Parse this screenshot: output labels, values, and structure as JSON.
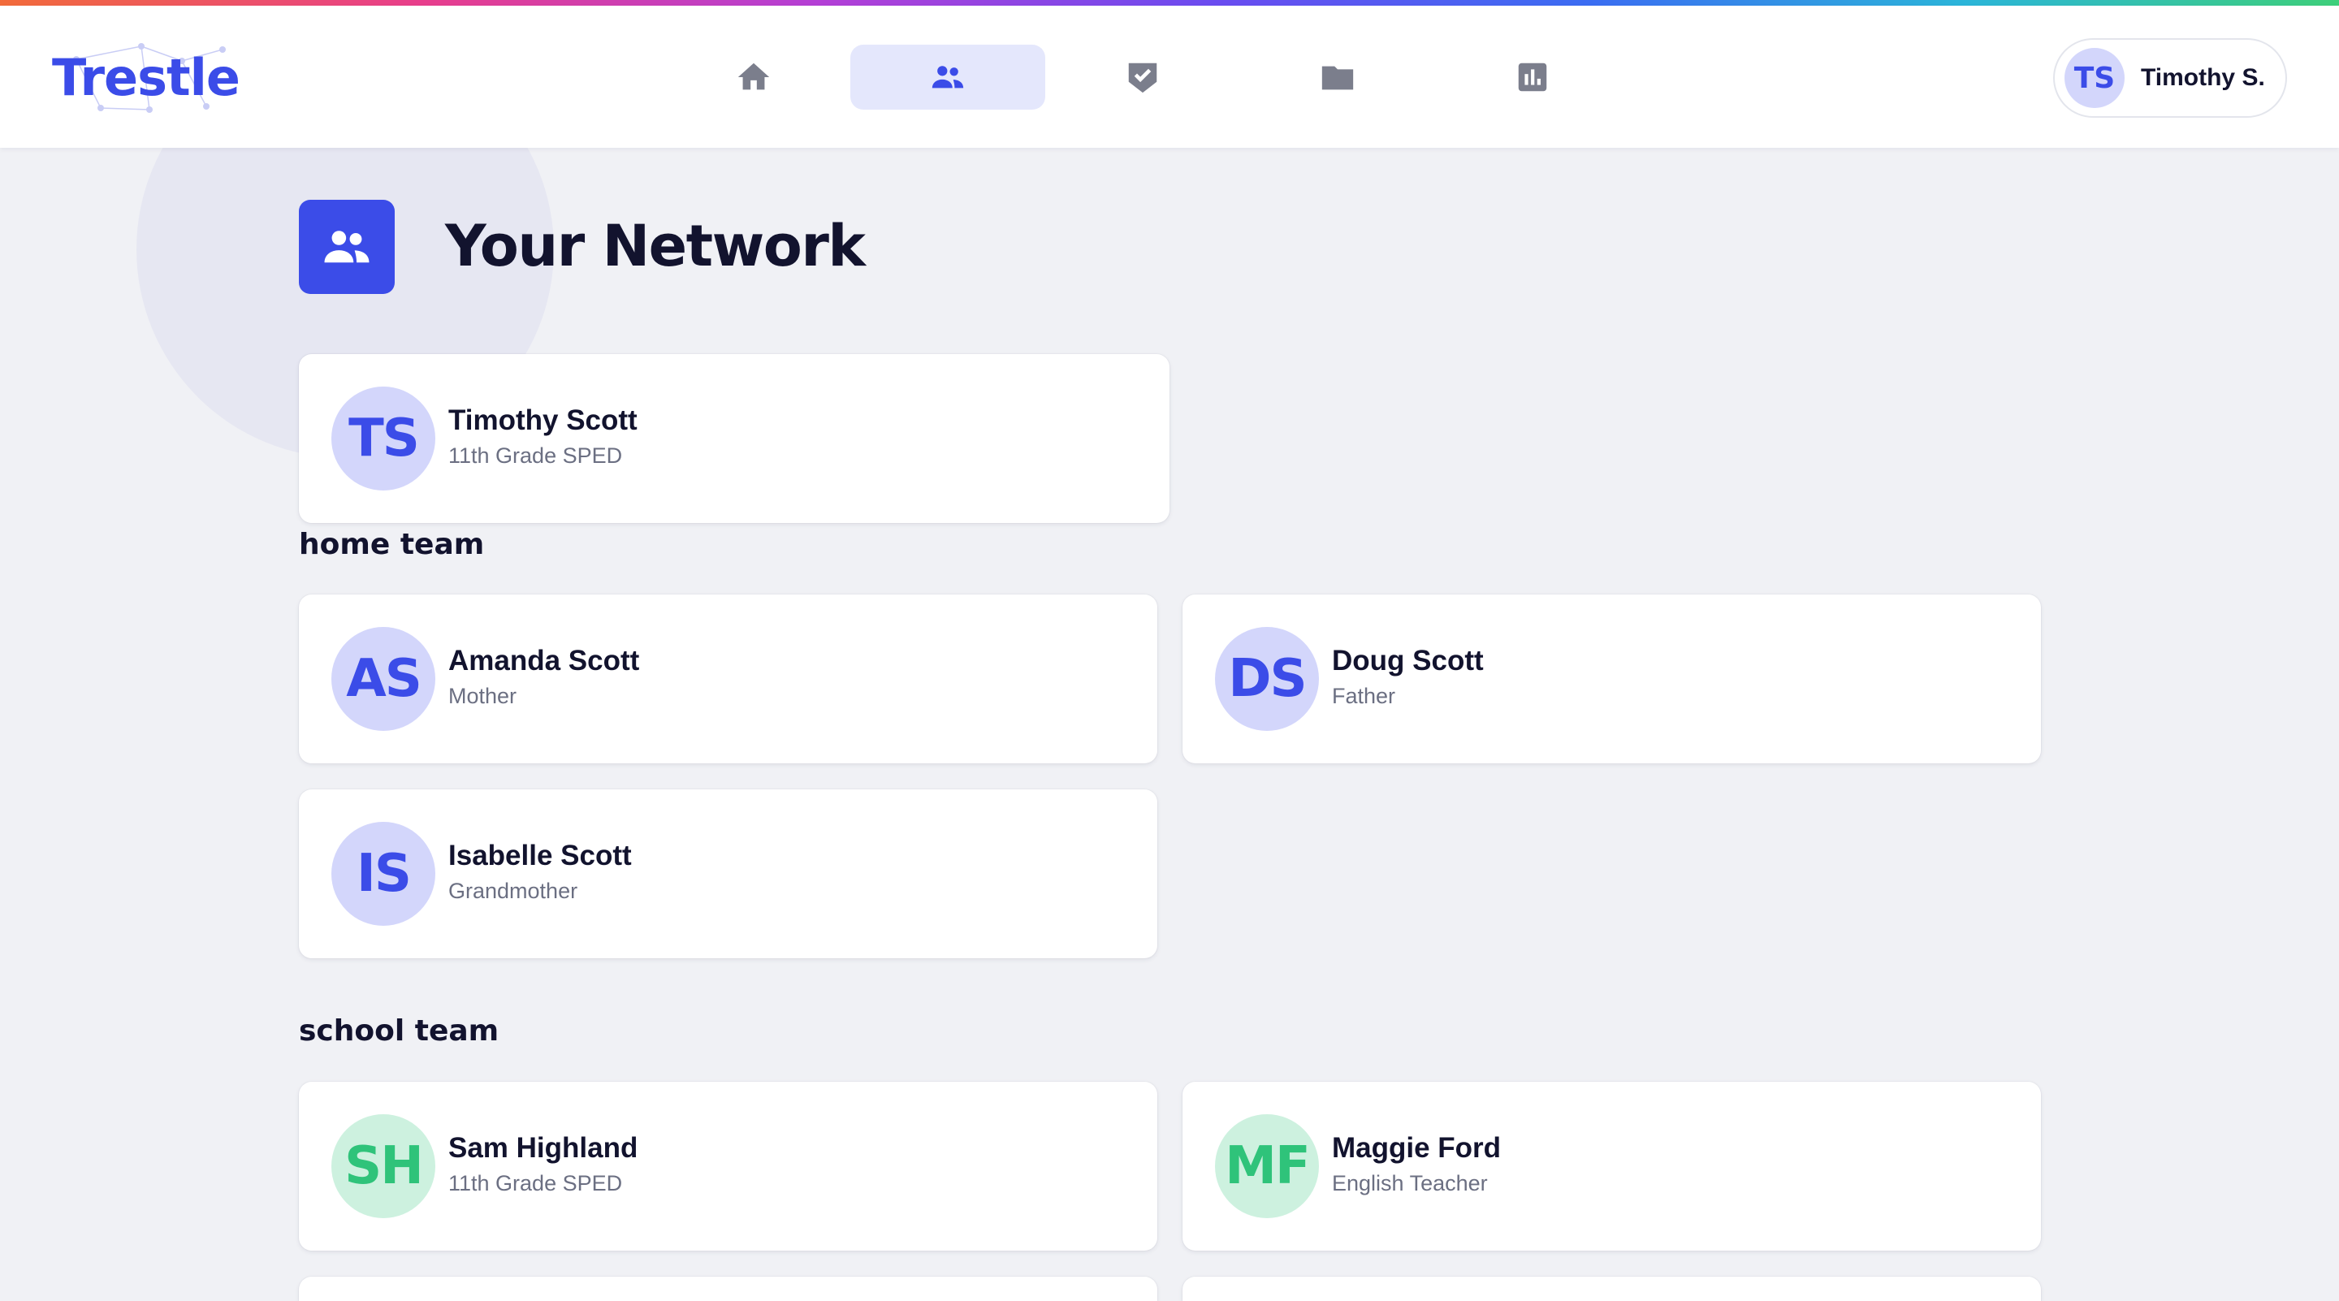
{
  "app": {
    "logo_text": "Trestle",
    "brand_color": "#3b4ce8"
  },
  "nav": {
    "items": [
      {
        "id": "home",
        "icon": "home-icon",
        "active": false
      },
      {
        "id": "network",
        "icon": "people-icon",
        "active": true
      },
      {
        "id": "tasks",
        "icon": "shield-check-icon",
        "active": false
      },
      {
        "id": "files",
        "icon": "folder-icon",
        "active": false
      },
      {
        "id": "reports",
        "icon": "bar-chart-icon",
        "active": false
      }
    ]
  },
  "profile": {
    "initials": "TS",
    "name": "Timothy S."
  },
  "page": {
    "title": "Your Network",
    "icon": "people-icon"
  },
  "student": {
    "initials": "TS",
    "name": "Timothy Scott",
    "role": "11th Grade SPED",
    "color": "blue"
  },
  "home_team": {
    "title": "home team",
    "members": [
      {
        "initials": "AS",
        "name": "Amanda Scott",
        "role": "Mother",
        "color": "blue"
      },
      {
        "initials": "DS",
        "name": "Doug Scott",
        "role": "Father",
        "color": "blue"
      },
      {
        "initials": "IS",
        "name": "Isabelle Scott",
        "role": "Grandmother",
        "color": "blue"
      }
    ]
  },
  "school_team": {
    "title": "school team",
    "members": [
      {
        "initials": "SH",
        "name": "Sam Highland",
        "role": "11th Grade SPED",
        "color": "green"
      },
      {
        "initials": "MF",
        "name": "Maggie Ford",
        "role": "English Teacher",
        "color": "green"
      }
    ]
  }
}
